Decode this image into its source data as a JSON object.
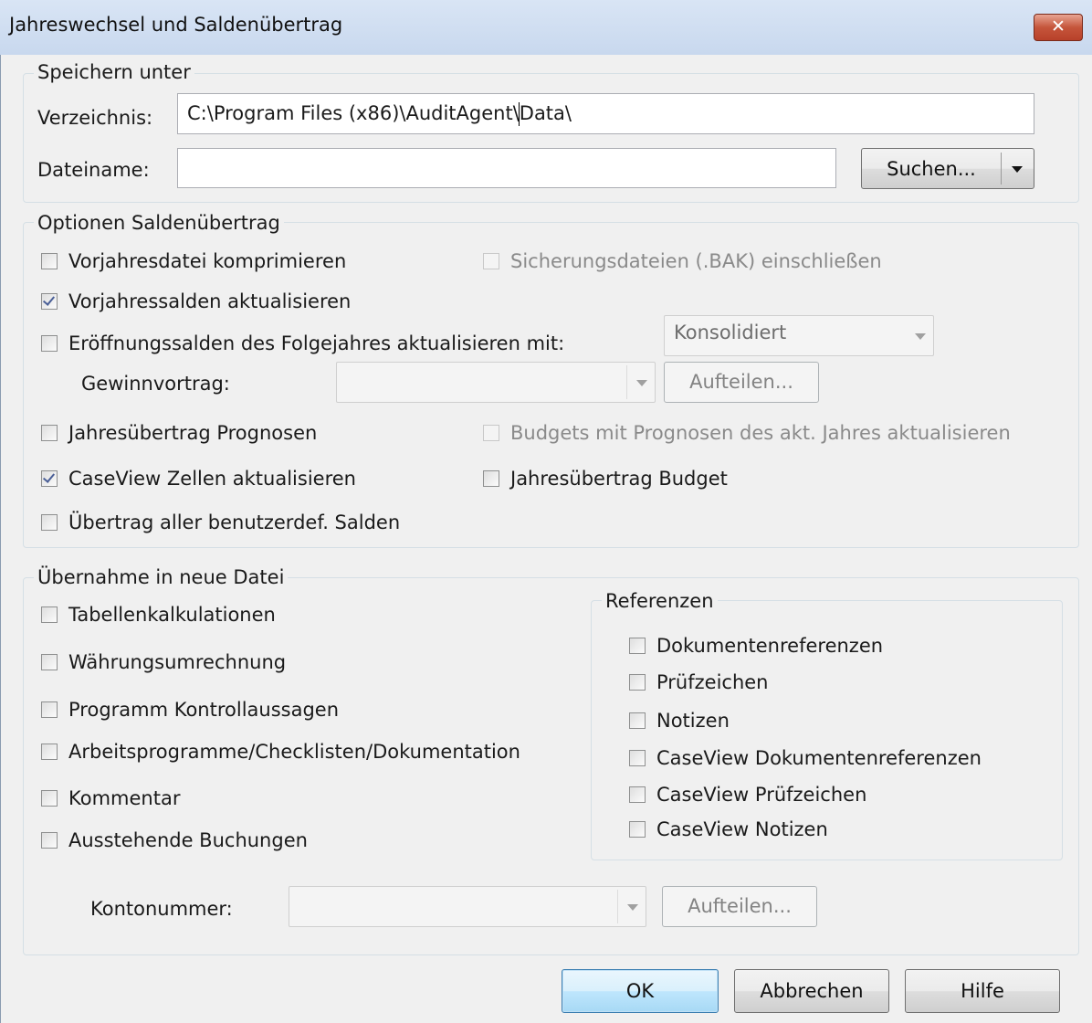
{
  "window": {
    "title": "Jahreswechsel und Saldenübertrag",
    "close_label": "✕"
  },
  "save_as": {
    "legend": "Speichern unter",
    "directory_label": "Verzeichnis:",
    "directory_value": "C:\\Program Files (x86)\\AuditAgent\\Data\\",
    "filename_label": "Dateiname:",
    "filename_value": "",
    "browse_label": "Suchen..."
  },
  "options": {
    "legend": "Optionen Saldenübertrag",
    "compress_prior": {
      "label": "Vorjahresdatei komprimieren",
      "checked": false
    },
    "include_backups": {
      "label": "Sicherungsdateien (.BAK) einschließen",
      "checked": false,
      "enabled": false
    },
    "update_prior_balances": {
      "label": "Vorjahressalden aktualisieren",
      "checked": true
    },
    "update_opening": {
      "label": "Eröffnungssalden des Folgejahres aktualisieren mit:",
      "checked": false
    },
    "update_opening_mode": "Konsolidiert",
    "retained_earnings_label": "Gewinnvortrag:",
    "retained_earnings_value": "",
    "split_label": "Aufteilen...",
    "rollforward_forecasts": {
      "label": "Jahresübertrag Prognosen",
      "checked": false
    },
    "update_budgets": {
      "label": "Budgets mit Prognosen des akt. Jahres aktualisieren",
      "checked": false,
      "enabled": false
    },
    "update_caseview": {
      "label": "CaseView Zellen aktualisieren",
      "checked": true
    },
    "rollforward_budget": {
      "label": "Jahresübertrag Budget",
      "checked": false
    },
    "rollforward_custom": {
      "label": "Übertrag aller benutzerdef. Salden",
      "checked": false
    }
  },
  "transfer": {
    "legend": "Übernahme in neue Datei",
    "spreadsheets": {
      "label": "Tabellenkalkulationen",
      "checked": false
    },
    "currency": {
      "label": "Währungsumrechnung",
      "checked": false
    },
    "program_assertions": {
      "label": "Programm Kontrollaussagen",
      "checked": false
    },
    "work_programs": {
      "label": "Arbeitsprogramme/Checklisten/Dokumentation",
      "checked": false
    },
    "comment": {
      "label": "Kommentar",
      "checked": false
    },
    "pending_entries": {
      "label": "Ausstehende Buchungen",
      "checked": false
    },
    "account_number_label": "Kontonummer:",
    "account_number_value": "",
    "split_label": "Aufteilen..."
  },
  "references": {
    "legend": "Referenzen",
    "doc_refs": {
      "label": "Dokumentenreferenzen",
      "checked": false
    },
    "tickmarks": {
      "label": "Prüfzeichen",
      "checked": false
    },
    "notes": {
      "label": "Notizen",
      "checked": false
    },
    "cv_doc_refs": {
      "label": "CaseView Dokumentenreferenzen",
      "checked": false
    },
    "cv_tickmarks": {
      "label": "CaseView Prüfzeichen",
      "checked": false
    },
    "cv_notes": {
      "label": "CaseView Notizen",
      "checked": false
    }
  },
  "footer": {
    "ok_label": "OK",
    "cancel_label": "Abbrechen",
    "help_label": "Hilfe"
  }
}
